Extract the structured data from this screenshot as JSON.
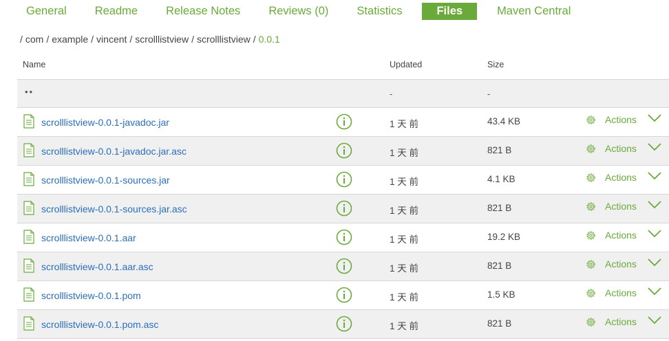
{
  "tabs": [
    {
      "label": "General",
      "active": false
    },
    {
      "label": "Readme",
      "active": false
    },
    {
      "label": "Release Notes",
      "active": false
    },
    {
      "label": "Reviews (0)",
      "active": false
    },
    {
      "label": "Statistics",
      "active": false
    },
    {
      "label": "Files",
      "active": true
    },
    {
      "label": "Maven Central",
      "active": false
    }
  ],
  "breadcrumb": {
    "leading_sep": "/",
    "items": [
      "com",
      "example",
      "vincent",
      "scrolllistview",
      "scrolllistview",
      "0.0.1"
    ]
  },
  "table": {
    "headers": {
      "name": "Name",
      "updated": "Updated",
      "size": "Size"
    },
    "parent_row": {
      "name": "••",
      "updated": "-",
      "size": "-"
    },
    "actions_label": "Actions",
    "rows": [
      {
        "name": "scrolllistview-0.0.1-javadoc.jar",
        "updated": "1 天 前",
        "size": "43.4 KB"
      },
      {
        "name": "scrolllistview-0.0.1-javadoc.jar.asc",
        "updated": "1 天 前",
        "size": "821 B"
      },
      {
        "name": "scrolllistview-0.0.1-sources.jar",
        "updated": "1 天 前",
        "size": "4.1 KB"
      },
      {
        "name": "scrolllistview-0.0.1-sources.jar.asc",
        "updated": "1 天 前",
        "size": "821 B"
      },
      {
        "name": "scrolllistview-0.0.1.aar",
        "updated": "1 天 前",
        "size": "19.2 KB"
      },
      {
        "name": "scrolllistview-0.0.1.aar.asc",
        "updated": "1 天 前",
        "size": "821 B"
      },
      {
        "name": "scrolllistview-0.0.1.pom",
        "updated": "1 天 前",
        "size": "1.5 KB"
      },
      {
        "name": "scrolllistview-0.0.1.pom.asc",
        "updated": "1 天 前",
        "size": "821 B"
      }
    ]
  },
  "icons": {
    "file": "file-icon",
    "info": "info-icon",
    "gear": "gear-icon",
    "chevron": "chevron-down-icon"
  },
  "colors": {
    "accent": "#6aaa3a",
    "link": "#2a6ebb",
    "row_alt": "#f0f0f0"
  }
}
